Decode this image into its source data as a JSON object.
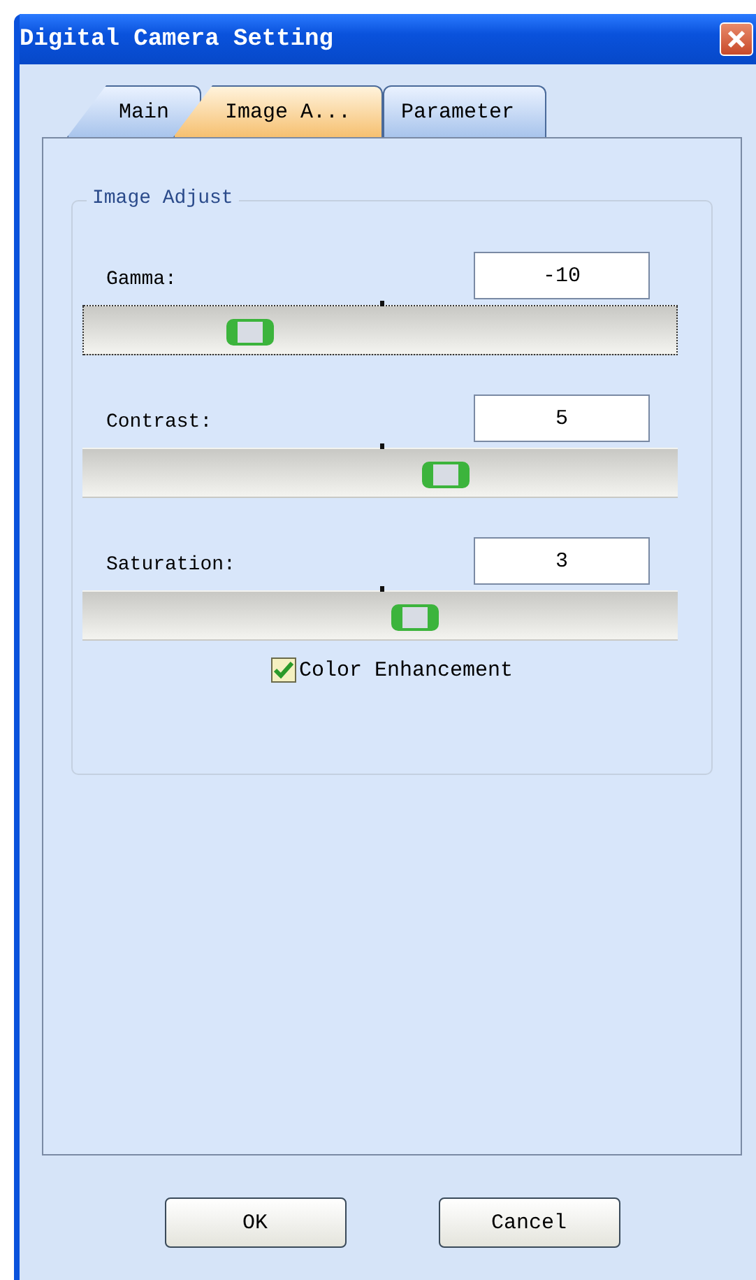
{
  "window": {
    "title": "Digital Camera Setting"
  },
  "tabs": [
    {
      "label": "Main",
      "selected": false
    },
    {
      "label": "Image A...",
      "selected": true
    },
    {
      "label": "Parameter",
      "selected": false
    }
  ],
  "group": {
    "title": "Image Adjust"
  },
  "sliders": [
    {
      "label": "Gamma:",
      "value": "-10",
      "level": 0.28,
      "focused": true
    },
    {
      "label": "Contrast:",
      "value": "5",
      "level": 0.61,
      "focused": false
    },
    {
      "label": "Saturation:",
      "value": "3",
      "level": 0.56,
      "focused": false
    }
  ],
  "checkbox": {
    "label": "Color Enhancement",
    "checked": true
  },
  "buttons": [
    "OK",
    "Cancel"
  ]
}
